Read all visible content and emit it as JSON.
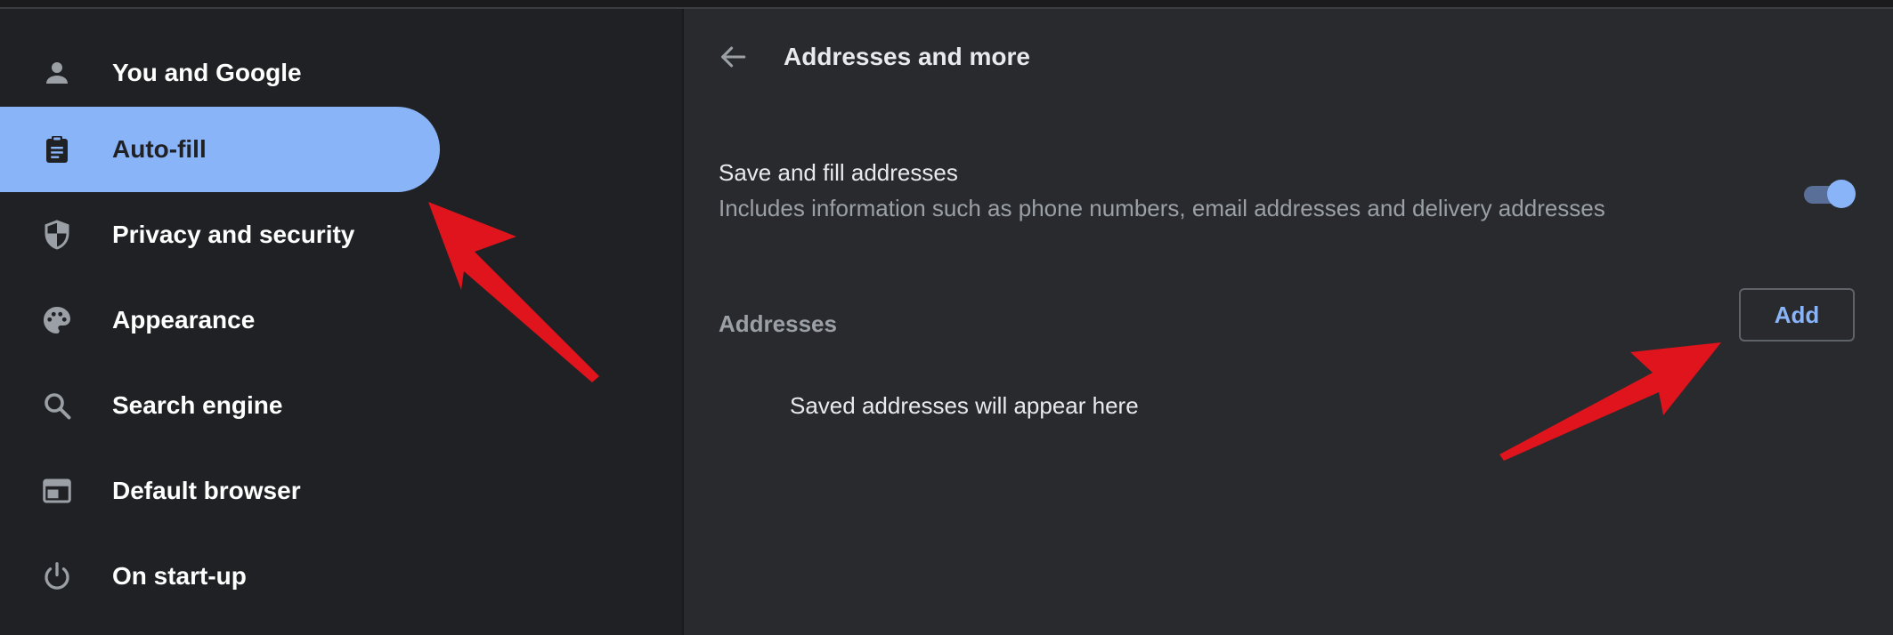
{
  "sidebar": {
    "items": [
      {
        "label": "You and Google",
        "icon": "person-icon",
        "active": false
      },
      {
        "label": "Auto-fill",
        "icon": "clipboard-icon",
        "active": true
      },
      {
        "label": "Privacy and security",
        "icon": "shield-icon",
        "active": false
      },
      {
        "label": "Appearance",
        "icon": "palette-icon",
        "active": false
      },
      {
        "label": "Search engine",
        "icon": "search-icon",
        "active": false
      },
      {
        "label": "Default browser",
        "icon": "browser-window-icon",
        "active": false
      },
      {
        "label": "On start-up",
        "icon": "power-icon",
        "active": false
      }
    ]
  },
  "main": {
    "back_icon": "arrow-back-icon",
    "title": "Addresses and more",
    "save_fill": {
      "title": "Save and fill addresses",
      "description": "Includes information such as phone numbers, email addresses and delivery addresses",
      "enabled": true
    },
    "addresses": {
      "section_label": "Addresses",
      "add_label": "Add",
      "empty_message": "Saved addresses will appear here"
    }
  },
  "colors": {
    "accent": "#8ab4f8",
    "sidebar_bg": "#202124",
    "main_bg": "#292a2d",
    "annotation_arrow": "#e0141c"
  }
}
